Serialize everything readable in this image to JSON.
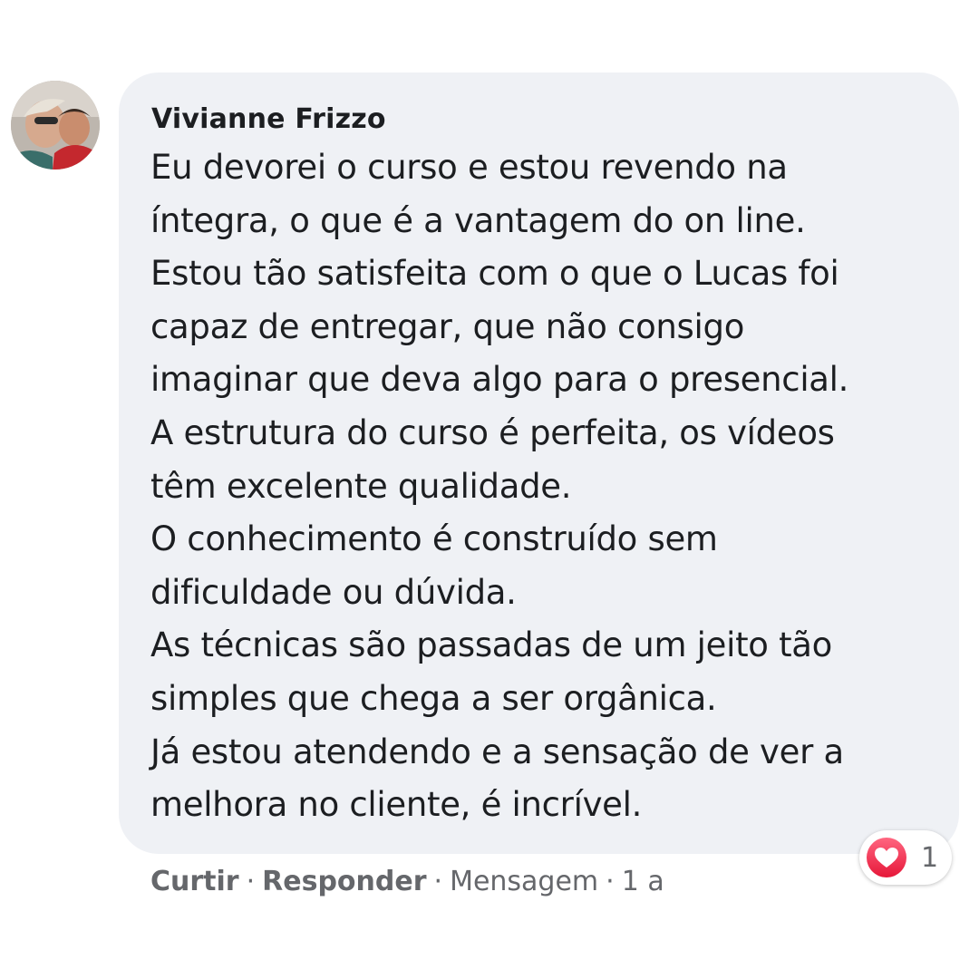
{
  "comment": {
    "author": "Vivianne Frizzo",
    "lines": [
      "Eu devorei o curso e estou revendo na",
      "íntegra, o que é a vantagem do on line.",
      "Estou tão satisfeita com o que o Lucas foi",
      "capaz de entregar, que não consigo",
      "imaginar que deva algo para o presencial.",
      "A estrutura do curso é perfeita, os vídeos",
      "têm excelente qualidade.",
      "O conhecimento é construído sem",
      "dificuldade ou dúvida.",
      "As técnicas são passadas de um jeito tão",
      "simples que chega a ser orgânica.",
      "Já estou atendendo e a sensação de ver a",
      "melhora no cliente, é incrível."
    ]
  },
  "reaction": {
    "icon": "heart-love-icon",
    "count": "1",
    "color": "#f33e58"
  },
  "actions": {
    "like": "Curtir",
    "reply": "Responder",
    "message": "Mensagem",
    "time": "1 a",
    "separator": "·"
  },
  "colors": {
    "bubble": "#eff1f5",
    "text": "#1c1e21",
    "muted": "#65676b"
  }
}
